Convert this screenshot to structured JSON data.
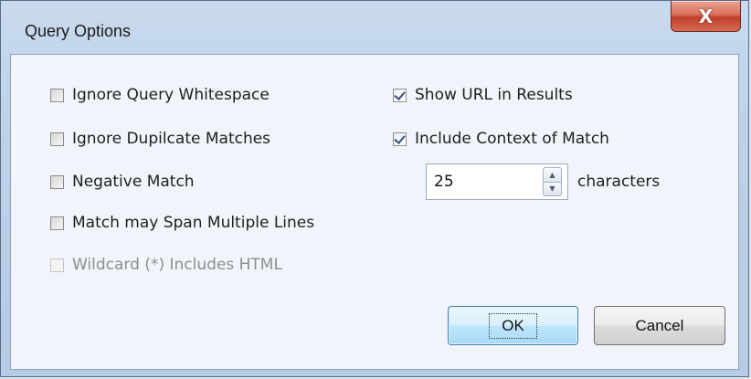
{
  "window": {
    "title": "Query Options",
    "close_icon": "X"
  },
  "options_left": [
    {
      "label": "Ignore Query Whitespace",
      "checked": false,
      "enabled": true
    },
    {
      "label": "Ignore Dupilcate Matches",
      "checked": false,
      "enabled": true
    },
    {
      "label": "Negative Match",
      "checked": false,
      "enabled": true
    },
    {
      "label": "Match may Span Multiple Lines",
      "checked": false,
      "enabled": true
    },
    {
      "label": "Wildcard (*) Includes HTML",
      "checked": false,
      "enabled": false
    }
  ],
  "options_right": [
    {
      "label": "Show URL in Results",
      "checked": true,
      "enabled": true
    },
    {
      "label": "Include Context of Match",
      "checked": true,
      "enabled": true
    }
  ],
  "context": {
    "value": "25",
    "suffix": "characters"
  },
  "buttons": {
    "ok": "OK",
    "cancel": "Cancel"
  }
}
